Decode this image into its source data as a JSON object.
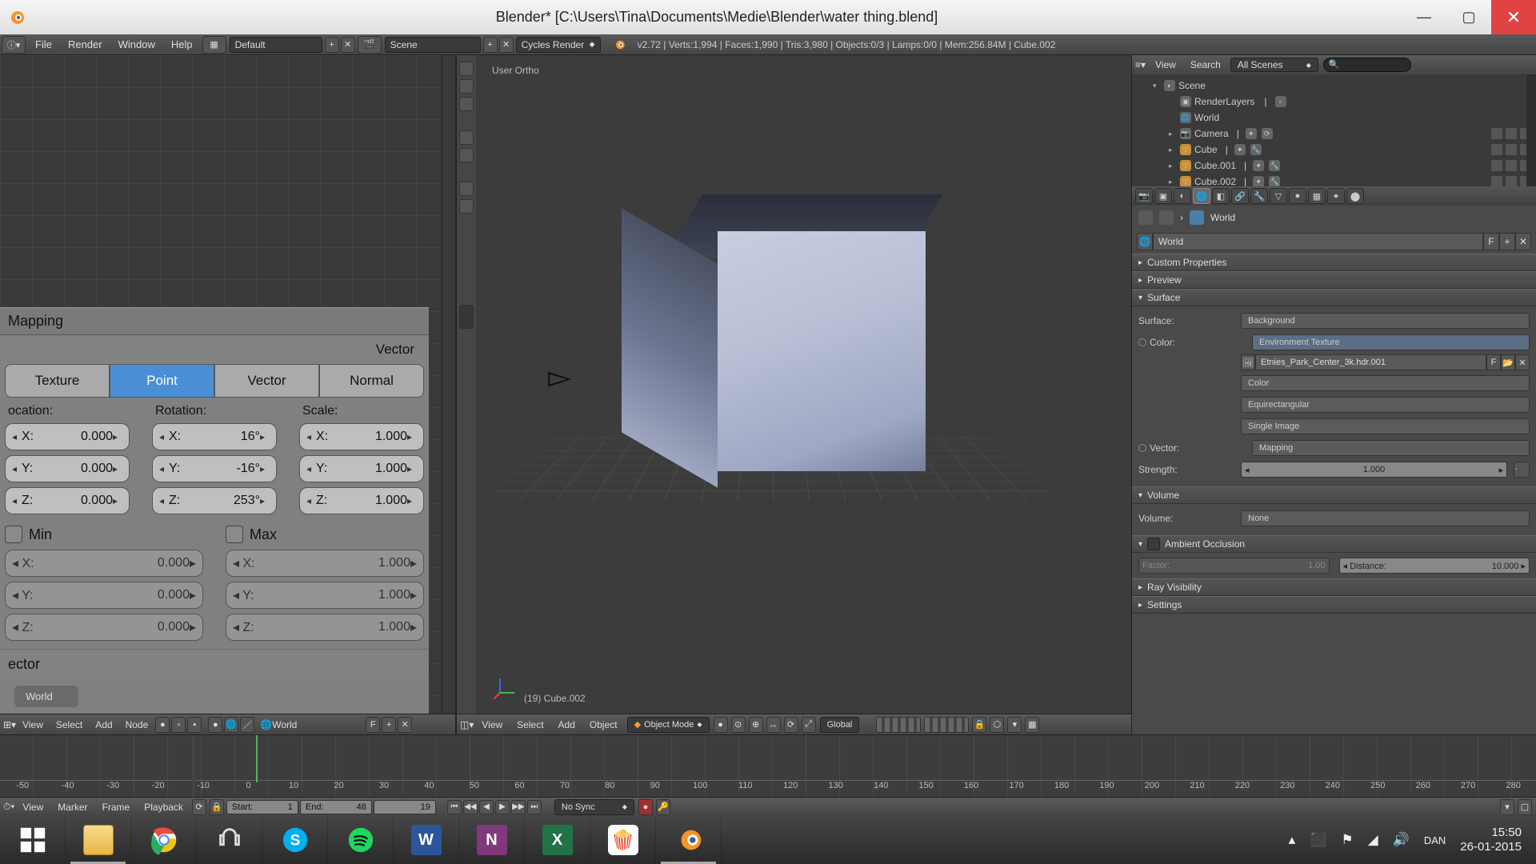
{
  "titlebar": {
    "title": "Blender* [C:\\Users\\Tina\\Documents\\Medie\\Blender\\water thing.blend]"
  },
  "menubar": {
    "file": "File",
    "render": "Render",
    "window": "Window",
    "help": "Help",
    "layout_name": "Default",
    "scene_name": "Scene",
    "engine": "Cycles Render",
    "stats": "v2.72 | Verts:1,994 | Faces:1,990 | Tris:3,980 | Objects:0/3 | Lamps:0/0 | Mem:256.84M | Cube.002"
  },
  "mapping": {
    "title": "Mapping",
    "output_label": "Vector",
    "tabs": {
      "t1": "Texture",
      "t2": "Point",
      "t3": "Vector",
      "t4": "Normal"
    },
    "location_label": "ocation:",
    "rotation_label": "Rotation:",
    "scale_label": "Scale:",
    "loc": {
      "x": "0.000",
      "y": "0.000",
      "z": "0.000"
    },
    "rot": {
      "x": "16°",
      "y": "-16°",
      "z": "253°"
    },
    "scl": {
      "x": "1.000",
      "y": "1.000",
      "z": "1.000"
    },
    "min_label": "Min",
    "max_label": "Max",
    "min": {
      "x": "0.000",
      "y": "0.000",
      "z": "0.000"
    },
    "max": {
      "x": "1.000",
      "y": "1.000",
      "z": "1.000"
    },
    "input_label": "ector",
    "crumb": "World"
  },
  "left_footer": {
    "view": "View",
    "select": "Select",
    "add": "Add",
    "node": "Node",
    "world": "World"
  },
  "viewport": {
    "projection": "User Ortho",
    "selected": "(19) Cube.002",
    "footer": {
      "view": "View",
      "select": "Select",
      "add": "Add",
      "object": "Object",
      "mode": "Object Mode",
      "orientation": "Global"
    }
  },
  "outliner": {
    "header": {
      "view": "View",
      "search": "Search",
      "filter": "All Scenes"
    },
    "items": [
      {
        "name": "Scene"
      },
      {
        "name": "RenderLayers"
      },
      {
        "name": "World"
      },
      {
        "name": "Camera"
      },
      {
        "name": "Cube"
      },
      {
        "name": "Cube.001"
      },
      {
        "name": "Cube.002"
      }
    ]
  },
  "breadcrumb": {
    "world": "World"
  },
  "world_selector": {
    "name": "World"
  },
  "panels": {
    "custom": "Custom Properties",
    "preview": "Preview",
    "surface": "Surface",
    "volume": "Volume",
    "ao": "Ambient Occlusion",
    "rayvis": "Ray Visibility",
    "settings": "Settings"
  },
  "surface": {
    "surface_label": "Surface:",
    "surface_val": "Background",
    "color_label": "Color:",
    "color_val": "Environment Texture",
    "tex_name": "Etnies_Park_Center_3k.hdr.001",
    "colorspace": "Color",
    "projection": "Equirectangular",
    "interp": "Single Image",
    "vector_label": "Vector:",
    "vector_val": "Mapping",
    "strength_label": "Strength:",
    "strength_val": "1.000"
  },
  "volume": {
    "label": "Volume:",
    "val": "None"
  },
  "ao": {
    "factor_label": "Factor:",
    "factor_val": "1.00",
    "distance_label": "Distance:",
    "distance_val": "10.000"
  },
  "timeline": {
    "ticks": [
      "-50",
      "-40",
      "-30",
      "-20",
      "-10",
      "0",
      "10",
      "20",
      "30",
      "40",
      "50",
      "60",
      "70",
      "80",
      "90",
      "100",
      "110",
      "120",
      "130",
      "140",
      "150",
      "160",
      "170",
      "180",
      "190",
      "200",
      "210",
      "220",
      "230",
      "240",
      "250",
      "260",
      "270",
      "280"
    ],
    "footer": {
      "view": "View",
      "marker": "Marker",
      "frame": "Frame",
      "playback": "Playback",
      "start_label": "Start:",
      "start_val": "1",
      "end_label": "End:",
      "end_val": "48",
      "current": "19",
      "sync": "No Sync"
    }
  },
  "tray": {
    "lang": "DAN",
    "time": "15:50",
    "date": "26-01-2015"
  }
}
